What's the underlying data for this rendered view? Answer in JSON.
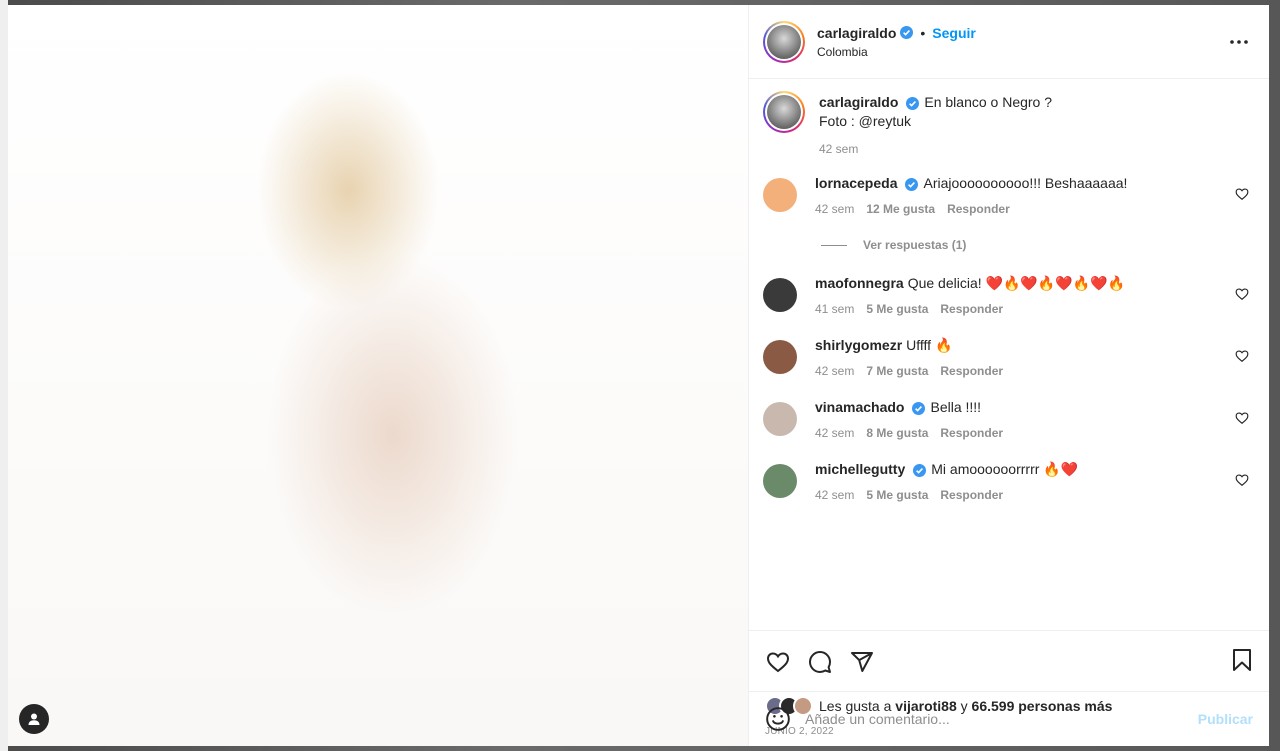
{
  "colors": {
    "accent": "#0095f6",
    "verified": "#3897f0",
    "muted_text": "#8e8e8e",
    "publish_disabled": "#b2dffc"
  },
  "post": {
    "author": {
      "username": "carlagiraldo",
      "verified": true,
      "follow_label": "Seguir",
      "separator": "•",
      "location": "Colombia"
    },
    "more_icon": "more-horizontal-icon",
    "caption": {
      "username": "carlagiraldo",
      "line1": "En blanco o Negro ?",
      "line2": "Foto : @reytuk",
      "time": "42 sem"
    },
    "comments": [
      {
        "username": "lornacepeda",
        "verified": true,
        "text": "Ariajoooooooooo!!! Beshaaaaaa!",
        "time": "42 sem",
        "likes": "12 Me gusta",
        "reply": "Responder",
        "avatar_color": "#f3b07a",
        "replies_label": "Ver respuestas (1)"
      },
      {
        "username": "maofonnegra",
        "verified": false,
        "text": "Que delicia! ❤️🔥❤️🔥❤️🔥❤️🔥",
        "time": "41 sem",
        "likes": "5 Me gusta",
        "reply": "Responder",
        "avatar_color": "#3a3a3a"
      },
      {
        "username": "shirlygomezr",
        "verified": false,
        "text": "Uffff 🔥",
        "time": "42 sem",
        "likes": "7 Me gusta",
        "reply": "Responder",
        "avatar_color": "#8a5a44"
      },
      {
        "username": "vinamachado",
        "verified": true,
        "text": "Bella !!!!",
        "time": "42 sem",
        "likes": "8 Me gusta",
        "reply": "Responder",
        "avatar_color": "#c9b8ad"
      },
      {
        "username": "michellegutty",
        "verified": true,
        "text": "Mi amoooooorrrrr 🔥❤️",
        "time": "42 sem",
        "likes": "5 Me gusta",
        "reply": "Responder",
        "avatar_color": "#6b8a6a"
      }
    ],
    "actions": {
      "like_icon": "heart-icon",
      "comment_icon": "comment-icon",
      "share_icon": "send-icon",
      "save_icon": "bookmark-icon"
    },
    "likes": {
      "prefix": "Les gusta a",
      "user": "vijaroti88",
      "connector": "y",
      "count": "66.599 personas más"
    },
    "date": "JUNIO 2, 2022",
    "add_comment": {
      "emoji_icon": "smiley-icon",
      "placeholder": "Añade un comentario...",
      "publish_label": "Publicar"
    }
  }
}
